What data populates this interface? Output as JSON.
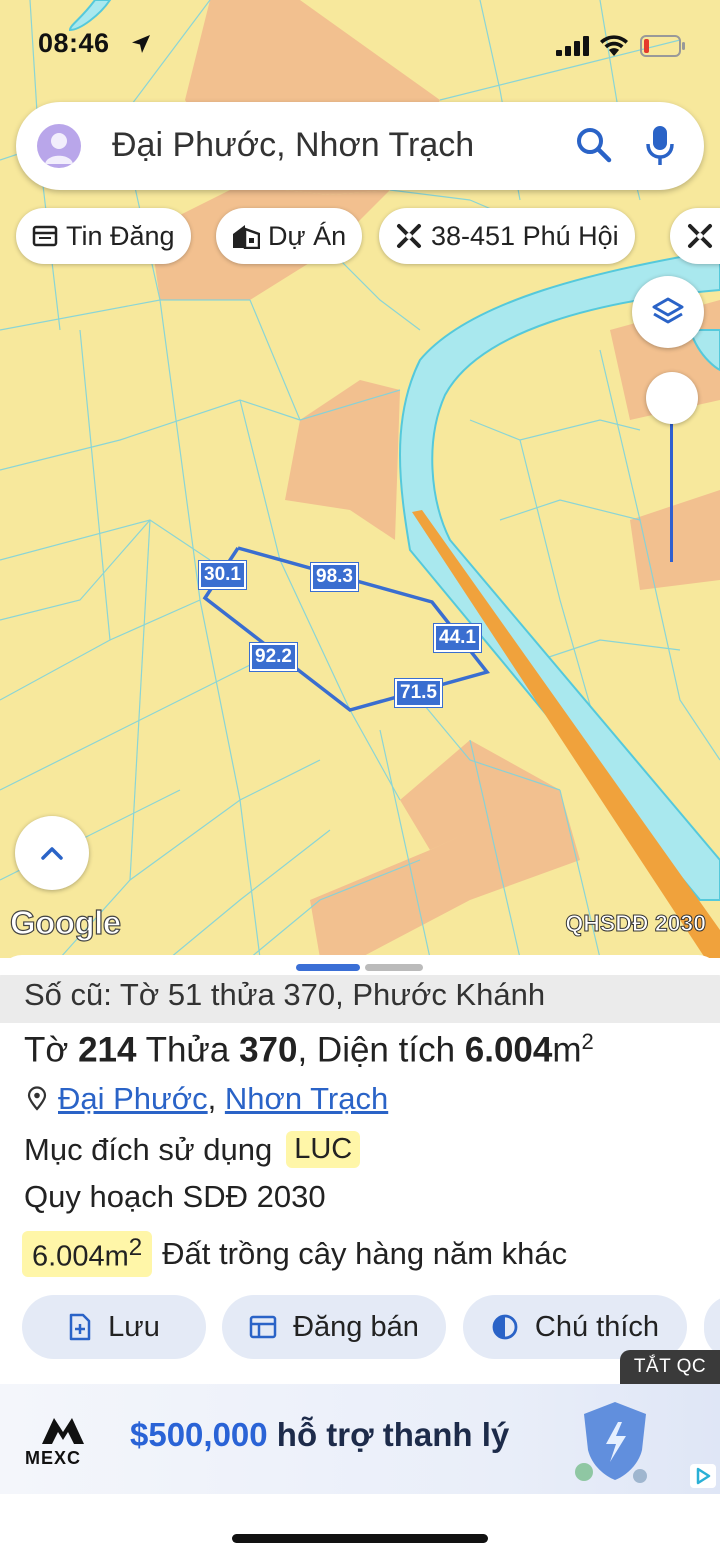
{
  "status_bar": {
    "time": "08:46"
  },
  "search": {
    "query": "Đại Phước, Nhơn Trạch"
  },
  "chips": [
    {
      "label": "Tin Đăng",
      "icon": "listing-icon"
    },
    {
      "label": "Dự Án",
      "icon": "building-icon"
    },
    {
      "label": "38-451 Phú Hội",
      "icon": "tools-icon"
    }
  ],
  "map": {
    "logo": "Google",
    "layer_badge": "QHSDĐ 2030",
    "parcel_dimensions": [
      "30.1",
      "98.3",
      "44.1",
      "71.5",
      "92.2"
    ]
  },
  "parcel": {
    "old_info": "Số cũ: Tờ 51 thửa 370, Phước Khánh",
    "sheet_label": "Tờ",
    "sheet_no": "214",
    "plot_label": "Thửa",
    "plot_no": "370",
    "area_label": ", Diện tích",
    "area_value": "6.004",
    "area_unit": "m",
    "area_sup": "2",
    "ward": "Đại Phước",
    "district": "Nhơn Trạch",
    "purpose_label": "Mục đích sử dụng",
    "purpose_code": "LUC",
    "plan_label": "Quy hoạch SDĐ 2030",
    "plan_area": "6.004m",
    "plan_area_sup": "2",
    "plan_type": "Đất trồng cây hàng năm khác"
  },
  "actions": {
    "save": "Lưu",
    "post": "Đăng bán",
    "legend": "Chú thích"
  },
  "ad": {
    "close_label": "TẮT QC",
    "brand": "MEXC",
    "amount": "$500,000",
    "text": " hỗ trợ thanh lý"
  },
  "colors": {
    "map_land": "#f7e89c",
    "map_zone": "#f2c08f",
    "river": "#a9e8ee",
    "river_edge": "#55c9db",
    "road": "#f0a23c",
    "parcel_outline": "#3a6ed0",
    "accent_blue": "#2a63c7"
  }
}
